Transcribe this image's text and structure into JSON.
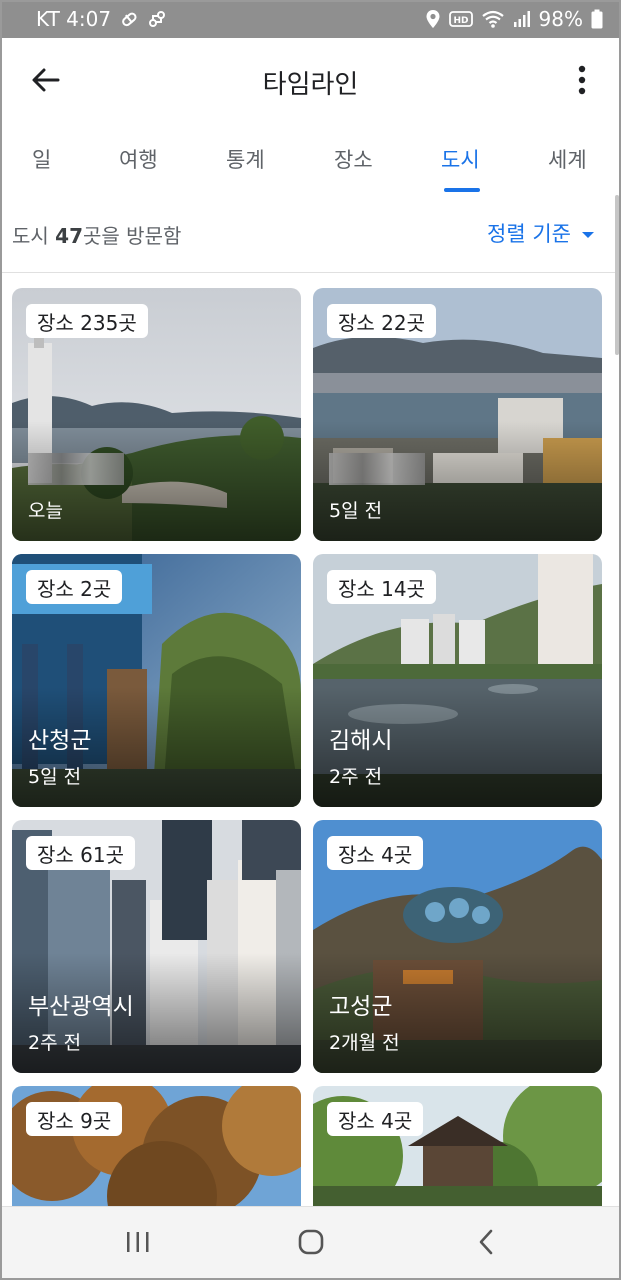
{
  "status_bar": {
    "carrier_time": "KT 4:07",
    "battery": "98%",
    "icons_left": [
      "pill-icon",
      "link-icon"
    ],
    "icons_right": [
      "location-icon",
      "hd-icon",
      "wifi-icon",
      "signal-icon",
      "battery-icon"
    ]
  },
  "header": {
    "title": "타임라인",
    "back_icon": "arrow-left-icon",
    "more_icon": "more-vertical-icon"
  },
  "tabs": [
    {
      "label": "일",
      "active": false
    },
    {
      "label": "여행",
      "active": false
    },
    {
      "label": "통계",
      "active": false
    },
    {
      "label": "장소",
      "active": false
    },
    {
      "label": "도시",
      "active": true
    },
    {
      "label": "세계",
      "active": false
    }
  ],
  "summary": {
    "prefix": "도시 ",
    "count": "47",
    "suffix": "곳을 방문함"
  },
  "sort": {
    "label": "정렬 기준",
    "icon": "dropdown-arrow-icon"
  },
  "cities": [
    {
      "places": "장소 235곳",
      "name": "",
      "time": "오늘"
    },
    {
      "places": "장소 22곳",
      "name": "",
      "time": "5일 전"
    },
    {
      "places": "장소 2곳",
      "name": "산청군",
      "time": "5일 전"
    },
    {
      "places": "장소 14곳",
      "name": "김해시",
      "time": "2주 전"
    },
    {
      "places": "장소 61곳",
      "name": "부산광역시",
      "time": "2주 전"
    },
    {
      "places": "장소 4곳",
      "name": "고성군",
      "time": "2개월 전"
    },
    {
      "places": "장소 9곳",
      "name": "",
      "time": ""
    },
    {
      "places": "장소 4곳",
      "name": "",
      "time": ""
    }
  ],
  "nav_bar": {
    "icons": [
      "recent-apps-icon",
      "home-icon",
      "back-icon"
    ]
  },
  "colors": {
    "accent": "#1a73e8",
    "status_bar": "#8f8f8f"
  }
}
